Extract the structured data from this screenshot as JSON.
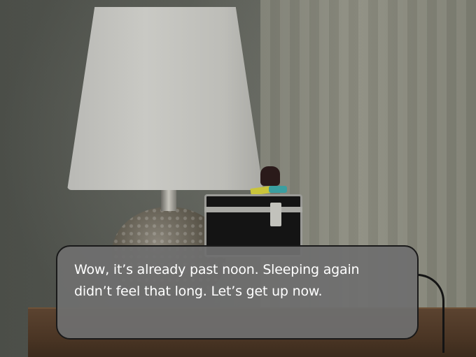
{
  "dialogue": {
    "text": "Wow, it’s already past noon. Sleeping again didn’t feel that long. Let’s get up now."
  },
  "scene": {
    "objects": [
      "table-lamp",
      "metal-box",
      "nightstand",
      "cable"
    ]
  }
}
